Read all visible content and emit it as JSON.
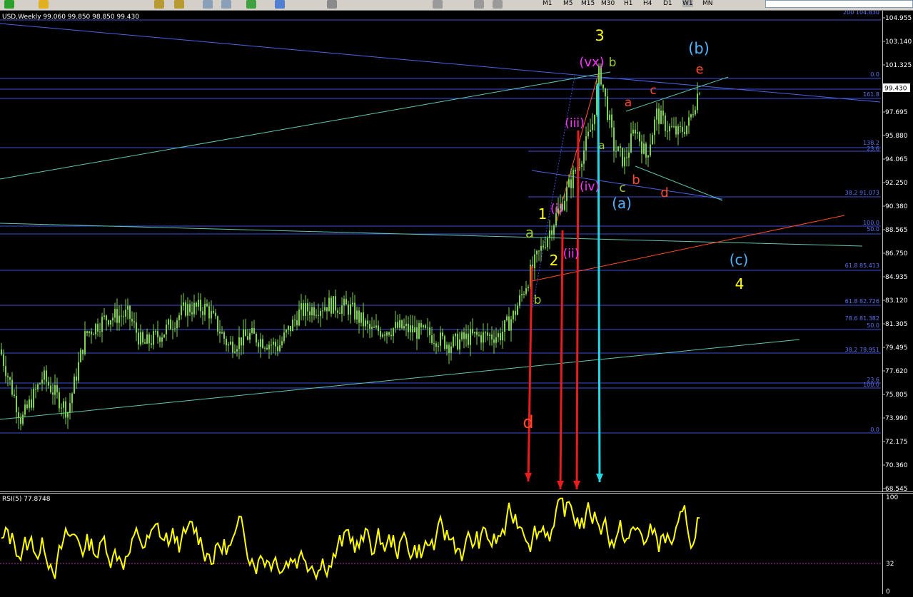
{
  "toolbar": {
    "timeframes": [
      "M1",
      "M5",
      "M15",
      "M30",
      "H1",
      "H4",
      "D1",
      "W1",
      "MN"
    ],
    "active_timeframe": "W1"
  },
  "chart_header": {
    "title": "USD,Weekly  99.060 99.850 98.850 99.430"
  },
  "rsi_header": {
    "title": "RSI(5) 77.8748"
  },
  "price_axis": {
    "labels": [
      "104.955",
      "103.140",
      "101.325",
      "99.430",
      "97.695",
      "95.880",
      "94.065",
      "92.250",
      "90.380",
      "88.565",
      "86.750",
      "84.935",
      "83.120",
      "81.305",
      "79.495",
      "77.620",
      "75.805",
      "73.990",
      "72.175",
      "70.360",
      "68.545"
    ],
    "current_price": "99.430"
  },
  "rsi_axis": {
    "labels": [
      "100",
      "32",
      "0"
    ]
  },
  "fib_labels": [
    "200 104.830",
    "0.0",
    "161.8",
    "138.2",
    "23.6",
    "38.2 91.073",
    "100.0",
    "50.0",
    "61.8 85.413",
    "61.8 82.726",
    "78.6 81.382",
    "50.0",
    "38.2 78.951",
    "23.6",
    "100.0",
    "0.0"
  ],
  "wave_labels": [
    "3",
    "(b)",
    "(vx)",
    "b",
    "e",
    "a",
    "c",
    "(iii)",
    "a",
    "(iv)",
    "b",
    "c",
    "d",
    "(a)",
    "1",
    "(i)",
    "a",
    "2",
    "(ii)",
    "b",
    "(c)",
    "4",
    "d"
  ],
  "colors": {
    "background": "#000000",
    "candles": "#7cd34c",
    "rsi_line": "#ffff00",
    "fib_line": "#3b4fd8",
    "trend_blue": "#4d62e6",
    "trend_teal": "#61c7b0",
    "red_arrow": "#e81c1c",
    "cyan_arrow": "#27d8e4"
  },
  "chart_data": {
    "type": "candlestick",
    "title": "USD,Weekly",
    "ylim": [
      68.545,
      104.955
    ],
    "last": {
      "open": 99.06,
      "high": 99.85,
      "low": 98.85,
      "close": 99.43
    },
    "path_close": [
      [
        0,
        79.3
      ],
      [
        30,
        73.8
      ],
      [
        60,
        77.2
      ],
      [
        95,
        74.5
      ],
      [
        120,
        80.5
      ],
      [
        150,
        81.8
      ],
      [
        180,
        82.0
      ],
      [
        200,
        79.6
      ],
      [
        230,
        80.7
      ],
      [
        260,
        82.5
      ],
      [
        290,
        82.5
      ],
      [
        320,
        79.6
      ],
      [
        350,
        80.4
      ],
      [
        390,
        79.5
      ],
      [
        420,
        82.2
      ],
      [
        460,
        82.8
      ],
      [
        490,
        82.5
      ],
      [
        520,
        80.7
      ],
      [
        560,
        81.0
      ],
      [
        600,
        80.5
      ],
      [
        630,
        79.7
      ],
      [
        660,
        80.3
      ],
      [
        700,
        80.4
      ],
      [
        720,
        82.0
      ],
      [
        745,
        85.5
      ],
      [
        770,
        88.5
      ],
      [
        790,
        91.0
      ],
      [
        805,
        93.0
      ],
      [
        820,
        95.0
      ],
      [
        830,
        96.8
      ],
      [
        840,
        101.0
      ],
      [
        850,
        98.0
      ],
      [
        860,
        95.0
      ],
      [
        875,
        93.8
      ],
      [
        890,
        96.5
      ],
      [
        905,
        94.2
      ],
      [
        920,
        97.5
      ],
      [
        935,
        96.5
      ],
      [
        950,
        96.0
      ],
      [
        965,
        96.8
      ],
      [
        982,
        100.0
      ]
    ],
    "rsi": {
      "name": "RSI(5)",
      "last": 77.8748,
      "ylim": [
        0,
        100
      ],
      "levels": [
        32
      ]
    }
  }
}
